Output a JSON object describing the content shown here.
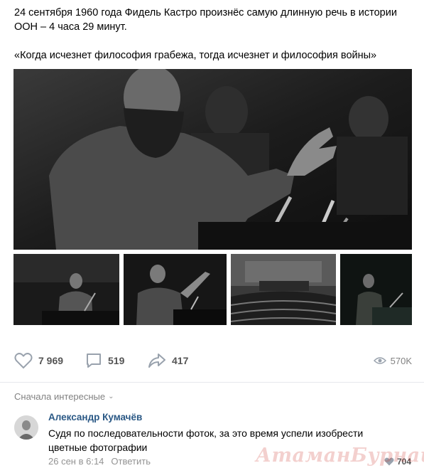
{
  "post": {
    "line1": "24 сентября 1960 года Фидель Кастро произнёс самую длинную речь в истории",
    "line2": "ООН – 4 часа 29 минут.",
    "quote": "«Когда исчезнет философия грабежа, тогда исчезнет и философия войны»"
  },
  "photos": {
    "main": "photo-castro-speech",
    "thumbs": [
      "photo-castro-podium",
      "photo-castro-gesture",
      "photo-un-assembly-hall",
      "photo-castro-dark-stage"
    ]
  },
  "actions": {
    "likes": "7 969",
    "comments": "519",
    "shares": "417",
    "views": "570K"
  },
  "comments": {
    "sort_label": "Сначала интересные",
    "items": [
      {
        "author": "Александр Кумачёв",
        "text": "Судя по последовательности фоток, за это время успели изобрести цветные фотографии",
        "date": "26 сен в 6:14",
        "reply_label": "Ответить",
        "likes": "704"
      }
    ]
  },
  "watermark": "АтаманБурнаш для ЯП",
  "colors": {
    "link": "#2a5885",
    "muted": "#828282",
    "icon": "#99a2ad"
  }
}
